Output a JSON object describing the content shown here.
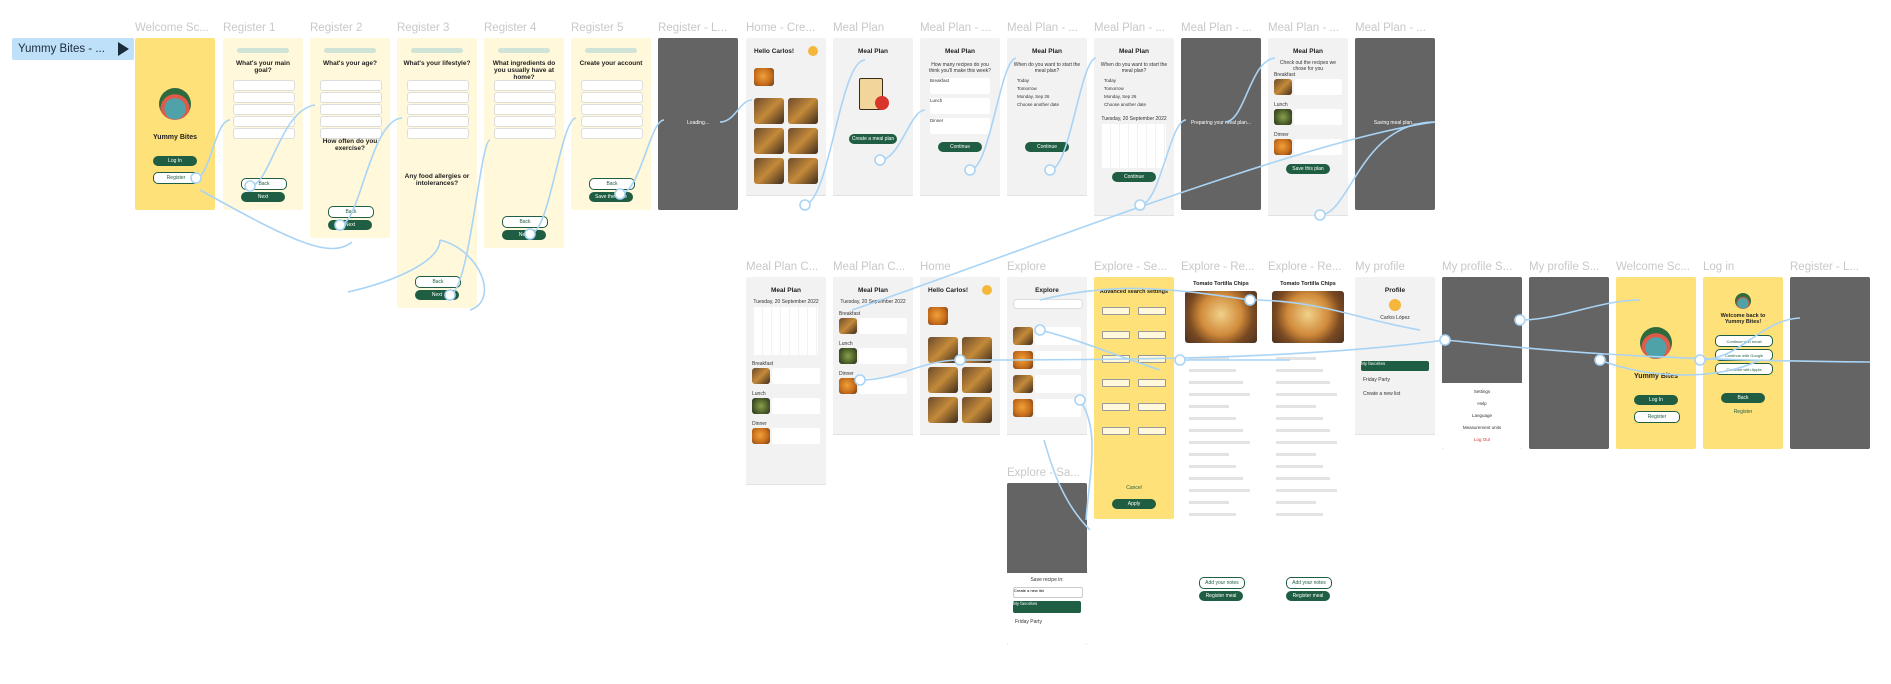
{
  "flow": {
    "label": "Yummy Bites - ..."
  },
  "frames": [
    {
      "id": "welcome",
      "title": "Welcome Sc...",
      "bg": "#ffe17a",
      "kind": "welcome",
      "lines": [
        "Yummy Bites"
      ],
      "buttons": [
        "Log In",
        "Register"
      ]
    },
    {
      "id": "register1",
      "title": "Register 1",
      "bg": "#fff8da",
      "kind": "form",
      "heading": "What's your main goal?",
      "buttons": [
        "Back",
        "Next"
      ]
    },
    {
      "id": "register2",
      "title": "Register 2",
      "bg": "#fff8da",
      "kind": "form",
      "heading": "What's your age?",
      "heading2": "How often do you exercise?",
      "buttons": [
        "Back",
        "Next"
      ]
    },
    {
      "id": "register3",
      "title": "Register 3",
      "bg": "#fff8da",
      "kind": "form",
      "heading": "What's your lifestyle?",
      "heading2": "Any food allergies or intolerances?",
      "buttons": [
        "Back",
        "Next"
      ]
    },
    {
      "id": "register4",
      "title": "Register 4",
      "bg": "#fff8da",
      "kind": "form",
      "heading": "What ingredients do you usually have at home?",
      "buttons": [
        "Back",
        "Next"
      ]
    },
    {
      "id": "register5",
      "title": "Register 5",
      "bg": "#fff8da",
      "kind": "form",
      "heading": "Create your account",
      "buttons": [
        "Back",
        "Save the base"
      ]
    },
    {
      "id": "registerL",
      "title": "Register - L...",
      "bg": "#7d7d7d",
      "kind": "loading",
      "lines": [
        "Loading..."
      ]
    },
    {
      "id": "homeCre",
      "title": "Home - Cre...",
      "bg": "#f2f2f2",
      "kind": "home",
      "heading": "Hello Carlos!"
    },
    {
      "id": "mealPlan",
      "title": "Meal Plan",
      "bg": "#f2f2f2",
      "kind": "mealintro",
      "heading": "Meal Plan",
      "buttons": [
        "Create a meal plan"
      ]
    },
    {
      "id": "mealPlan2",
      "title": "Meal Plan - ...",
      "bg": "#f2f2f2",
      "kind": "mealq",
      "heading": "Meal Plan",
      "sub": "How many recipes do you think you'll make this week?",
      "options": [
        "Breakfast",
        "Lunch",
        "Dinner"
      ],
      "buttons": [
        "Continue"
      ]
    },
    {
      "id": "mealPlan3",
      "title": "Meal Plan - ...",
      "bg": "#f2f2f2",
      "kind": "mealwhen",
      "heading": "Meal Plan",
      "sub": "When do you want to start the meal plan?",
      "options": [
        "Today",
        "Tomorrow",
        "Monday, Sep 26",
        "Choose another date"
      ],
      "buttons": [
        "Continue"
      ]
    },
    {
      "id": "mealPlan4",
      "title": "Meal Plan - ...",
      "bg": "#f2f2f2",
      "kind": "mealcal",
      "heading": "Meal Plan",
      "sub": "When do you want to start the meal plan?",
      "options": [
        "Today",
        "Tomorrow",
        "Monday, Sep 26",
        "Choose another date"
      ],
      "date": "Tuesday, 20 September 2022",
      "buttons": [
        "Continue"
      ]
    },
    {
      "id": "mealPlan5",
      "title": "Meal Plan - ...",
      "bg": "#7d7d7d",
      "kind": "loading",
      "lines": [
        "Preparing your meal plan..."
      ]
    },
    {
      "id": "mealPlan6",
      "title": "Meal Plan - ...",
      "bg": "#f2f2f2",
      "kind": "mealcheck",
      "heading": "Meal Plan",
      "sub": "Check out the recipes we chose for you",
      "sections": [
        "Breakfast",
        "Lunch",
        "Dinner"
      ],
      "buttons": [
        "Save this plan"
      ]
    },
    {
      "id": "mealPlan7",
      "title": "Meal Plan - ...",
      "bg": "#7d7d7d",
      "kind": "loading",
      "lines": [
        "Saving meal plan..."
      ]
    },
    {
      "id": "mealPlanC",
      "title": "Meal Plan C...",
      "bg": "#f2f2f2",
      "kind": "mealcal2",
      "heading": "Meal Plan",
      "date": "Tuesday, 20 September 2022",
      "sections": [
        "Breakfast",
        "Lunch",
        "Dinner"
      ]
    },
    {
      "id": "mealPlanC2",
      "title": "Meal Plan C...",
      "bg": "#f2f2f2",
      "kind": "mealday",
      "heading": "Meal Plan",
      "date": "Tuesday, 20 September 2022",
      "sections": [
        "Breakfast",
        "Lunch",
        "Dinner"
      ]
    },
    {
      "id": "home",
      "title": "Home",
      "bg": "#f2f2f2",
      "kind": "home",
      "heading": "Hello Carlos!"
    },
    {
      "id": "explore",
      "title": "Explore",
      "bg": "#f2f2f2",
      "kind": "explore",
      "heading": "Explore"
    },
    {
      "id": "exploreSe",
      "title": "Explore - Se...",
      "bg": "#ffe17a",
      "kind": "filters",
      "heading": "Advanced search settings",
      "buttons": [
        "Cancel",
        "Apply"
      ]
    },
    {
      "id": "exploreRe",
      "title": "Explore - Re...",
      "bg": "#ffffff",
      "kind": "recipe",
      "heading": "Tomato Tortilla Chips",
      "buttons": [
        "Add your notes",
        "Register meal"
      ]
    },
    {
      "id": "exploreRe2",
      "title": "Explore - Re...",
      "bg": "#ffffff",
      "kind": "recipe",
      "heading": "Tomato Tortilla Chips",
      "buttons": [
        "Add your notes",
        "Register meal"
      ]
    },
    {
      "id": "myProfile",
      "title": "My profile",
      "bg": "#f2f2f2",
      "kind": "profile",
      "heading": "Profile",
      "lines": [
        "Carlos López",
        "My favorites",
        "Friday Party",
        "Create a new list"
      ]
    },
    {
      "id": "myProfileS",
      "title": "My profile S...",
      "bg": "#7d7d7d",
      "kind": "profilemenu",
      "lines": [
        "Settings",
        "Help",
        "Language",
        "Measurement units",
        "Log Out"
      ]
    },
    {
      "id": "myProfileS2",
      "title": "My profile S...",
      "bg": "#7d7d7d",
      "kind": "loading",
      "lines": [
        ""
      ]
    },
    {
      "id": "welcome2",
      "title": "Welcome Sc...",
      "bg": "#ffe17a",
      "kind": "welcome",
      "lines": [
        "Yummy Bites"
      ],
      "buttons": [
        "Log In",
        "Register"
      ]
    },
    {
      "id": "login",
      "title": "Log in",
      "bg": "#ffe17a",
      "kind": "login",
      "heading": "Welcome back to Yummy Bites!",
      "options": [
        "Continue with email",
        "Continue with Google",
        "Continue with Apple"
      ],
      "buttons": [
        "Back",
        "Register"
      ]
    },
    {
      "id": "registerL2",
      "title": "Register - L...",
      "bg": "#7d7d7d",
      "kind": "loading",
      "lines": [
        ""
      ]
    },
    {
      "id": "exploreSa",
      "title": "Explore - Sa...",
      "bg": "#7d7d7d",
      "kind": "savesheet",
      "lines": [
        "Save recipe in:",
        "Create a new list",
        "My favorites",
        "Friday Party"
      ]
    }
  ]
}
